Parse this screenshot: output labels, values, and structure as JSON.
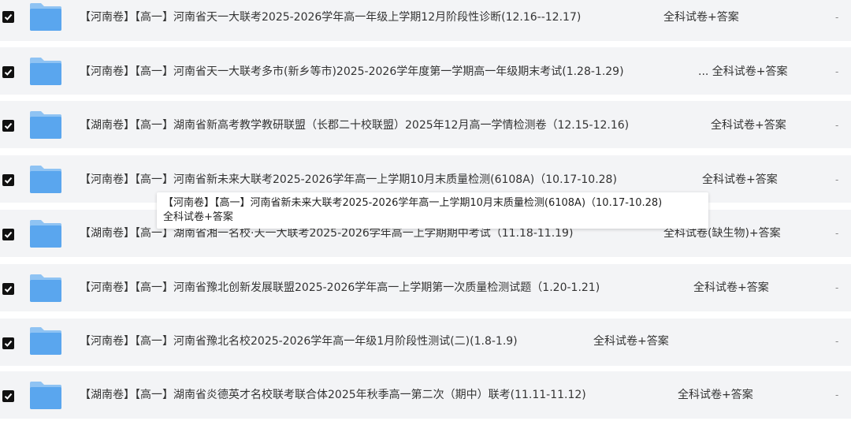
{
  "rows": [
    {
      "title": "【河南卷】【高一】河南省天一大联考2025-2026学年高一年级上学期12月阶段性诊断(12.16--12.17)",
      "tag": "全科试卷+答案",
      "dash": "-",
      "checked": true
    },
    {
      "title": "【河南卷】【高一】河南省天一大联考多市(新乡等市)2025-2026学年度第一学期高一年级期末考试(1.28-1.29)",
      "tag": "... 全科试卷+答案",
      "dash": "-",
      "checked": true
    },
    {
      "title": "【湖南卷】【高一】湖南省新高考教学教研联盟（长郡二十校联盟）2025年12月高一学情检测卷（12.15-12.16)",
      "tag": "全科试卷+答案",
      "dash": "-",
      "checked": true
    },
    {
      "title": "【河南卷】【高一】河南省新未来大联考2025-2026学年高一上学期10月末质量检测(6108A)（10.17-10.28)",
      "tag": "全科试卷+答案",
      "dash": "-",
      "checked": true
    },
    {
      "title": "【湖南卷】【高一】湖南省湘一名校·天一大联考2025-2026学年高一上学期期中考试（11.18-11.19)",
      "tag": "全科试卷(缺生物)+答案",
      "dash": "-",
      "checked": true
    },
    {
      "title": "【河南卷】【高一】河南省豫北创新发展联盟2025-2026学年高一上学期第一次质量检测试题（1.20-1.21)",
      "tag": "全科试卷+答案",
      "dash": "-",
      "checked": true
    },
    {
      "title": "【河南卷】【高一】河南省豫北名校2025-2026学年高一年级1月阶段性测试(二)(1.8-1.9)",
      "tag": "全科试卷+答案",
      "dash": "-",
      "checked": true
    },
    {
      "title": "【湖南卷】【高一】湖南省炎德英才名校联考联合体2025年秋季高一第二次（期中）联考(11.11-11.12)",
      "tag": "全科试卷+答案",
      "dash": "-",
      "checked": true
    }
  ],
  "tooltip": {
    "line1": "【河南卷】【高一】河南省新未来大联考2025-2026学年高一上学期10月末质量检测(6108A)（10.17-10.28)",
    "line2": "全科试卷+答案"
  },
  "colors": {
    "row_bg": "#f3f4f6",
    "folder_back": "#8fc3f3",
    "folder_front": "#5aa6ee",
    "checkbox": "#111111"
  },
  "icons": {
    "checkbox": "checkbox-checked-icon",
    "folder": "folder-icon"
  }
}
